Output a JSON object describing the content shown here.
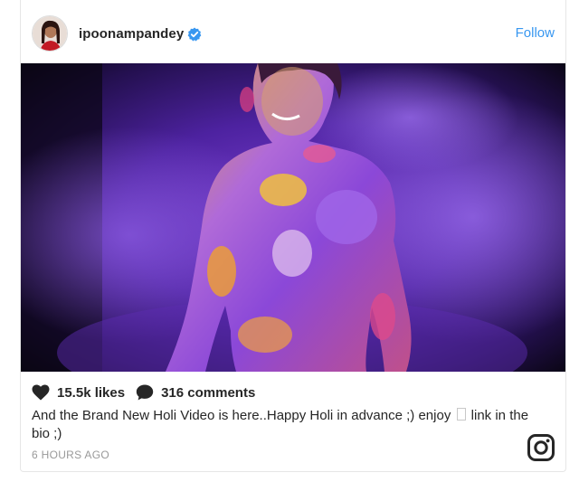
{
  "post": {
    "username": "ipoonampandey",
    "follow_label": "Follow",
    "likes": "15.5k likes",
    "comments": "316 comments",
    "caption_before": "And the Brand New Holi Video is here..Happy Holi in advance ;) enjoy",
    "caption_after": "link in the bio ;)",
    "timestamp": "6 HOURS AGO"
  },
  "icons": {
    "verified": "verified-badge-icon",
    "like": "heart-icon",
    "comment": "comment-bubble-icon",
    "brand": "instagram-logo-icon"
  },
  "colors": {
    "link": "#3897f0",
    "text": "#262626",
    "muted": "#999999",
    "verified": "#3897f0"
  }
}
